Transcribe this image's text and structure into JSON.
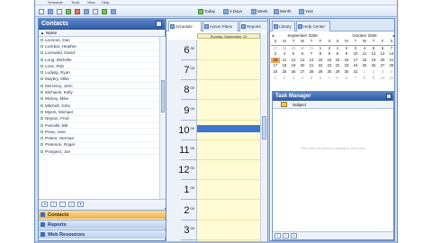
{
  "menu": {
    "items": [
      "",
      "",
      "Schedule",
      "Tools",
      "View",
      "Help"
    ]
  },
  "toolbar": {
    "today": "Today",
    "days": "3 Days",
    "week": "Week",
    "month": "Month",
    "year": "Year"
  },
  "contacts": {
    "title": "Contacts",
    "column": "Name",
    "rows": [
      "Leonore, Dan",
      "Lockbar, Heather",
      "Loerwald, David",
      "Long, Michelle",
      "Love, Rob",
      "Ludwig, Ryan",
      "Maybry, Mike",
      "McHenry, John",
      "Michaels, Kelly",
      "Mickey, Mike",
      "Mitchell, John",
      "Myers, Michael",
      "Neyton, Fred",
      "Parcells, Bill",
      "Pena, Jose",
      "Peters, Herman",
      "Peterson, Roger",
      "Prospect, Joe"
    ]
  },
  "nav": {
    "contacts": "Contacts",
    "reports": "Reports",
    "web_resources": "Web Resources"
  },
  "schedule": {
    "tabs": [
      "Schedule",
      "Action Plans",
      "Reports"
    ],
    "day_header": "Sunday, September 10",
    "hours": [
      "6",
      "7",
      "8",
      "9",
      "10",
      "11",
      "12",
      "1",
      "2",
      "3"
    ],
    "minute_marker": "00"
  },
  "right_tabs": [
    "Library",
    "Help Center"
  ],
  "calendar_left": {
    "month": "September 2006",
    "weekdays": [
      "S",
      "M",
      "T",
      "W",
      "T",
      "F",
      "S"
    ],
    "days": [
      "27",
      "28",
      "29",
      "30",
      "31",
      "1",
      "2",
      "3",
      "4",
      "5",
      "6",
      "7",
      "8",
      "9",
      "10",
      "11",
      "12",
      "13",
      "14",
      "15",
      "16",
      "17",
      "18",
      "19",
      "20",
      "21",
      "22",
      "23",
      "24",
      "25",
      "26",
      "27",
      "28",
      "29",
      "30",
      "1",
      "2",
      "3",
      "4",
      "5",
      "6",
      "7"
    ],
    "today_index": 14
  },
  "calendar_right": {
    "month": "October 2006",
    "weekdays": [
      "S",
      "M",
      "T",
      "W",
      "T",
      "F",
      "S"
    ],
    "days": [
      "1",
      "2",
      "3",
      "4",
      "5",
      "6",
      "7",
      "8",
      "9",
      "10",
      "11",
      "12",
      "13",
      "14",
      "15",
      "16",
      "17",
      "18",
      "19",
      "20",
      "21",
      "22",
      "23",
      "24",
      "25",
      "26",
      "27",
      "28",
      "29",
      "30",
      "31",
      "1",
      "2",
      "3",
      "4",
      "5",
      "6",
      "7",
      "8",
      "9",
      "10",
      "11"
    ]
  },
  "task": {
    "title": "Task Manager",
    "column": "Subject",
    "empty": "There are no items to display in this view."
  }
}
